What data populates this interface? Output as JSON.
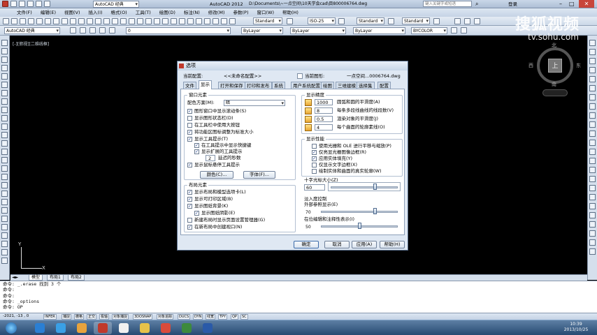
{
  "app": {
    "title": "AutoCAD 2012",
    "file_path": "D:\\Documents\\~一点空间\\10天学会cad\\目800006764.dwg",
    "workspace": "AutoCAD 经典",
    "search_placeholder": "键入关键字或短语",
    "login": "登录"
  },
  "menu": [
    "文件(F)",
    "编辑(E)",
    "视图(V)",
    "插入(I)",
    "格式(O)",
    "工具(T)",
    "绘图(D)",
    "标注(N)",
    "修改(M)",
    "参数(P)",
    "窗口(W)",
    "帮助(H)"
  ],
  "toolbar": {
    "text_style": "Standard",
    "dim_style": "ISO-25",
    "table_style": "Standard",
    "multileader_style": "Standard",
    "workspace_combo": "AutoCAD 经典",
    "layer": "0",
    "color": "ByLayer",
    "linetype": "ByLayer",
    "lineweight": "ByLayer",
    "plotstyle": "BYCOLOR"
  },
  "viewport_label": "[-][俯视][二维线框]",
  "watermark": {
    "brand": "搜狐视频",
    "url": "tv.sohu.com"
  },
  "viewcube": {
    "north": "北",
    "south": "南",
    "east": "东",
    "west": "西",
    "top": "上"
  },
  "layout_tabs": [
    "模型",
    "布局1",
    "布局2"
  ],
  "command_lines": [
    "命令: _.erase 找到 3 个",
    "命令:",
    "命令:",
    "命令: _options",
    "命令: OP"
  ],
  "status": {
    "coords": "-2021, -13 , 0",
    "buttons": [
      "INFER",
      "捕捉",
      "栅格",
      "正交",
      "极轴",
      "对象捕捉",
      "3DOSNAP",
      "对象追踪",
      "DUCS",
      "DYN",
      "线宽",
      "TPY",
      "QP",
      "SC"
    ]
  },
  "taskbar": {
    "time": "10:39",
    "date": "2013/10/25"
  },
  "dialog": {
    "title": "选项",
    "current_profile_label": "当前配置:",
    "current_profile_value": "<<未命名配置>>",
    "current_drawing_label": "当前图形:",
    "current_drawing_value": "一点空间...0006764.dwg",
    "tabs": [
      "文件",
      "显示",
      "打开和保存",
      "打印和发布",
      "系统",
      "用户系统配置",
      "绘图",
      "三维建模",
      "选择集",
      "配置"
    ],
    "active_tab": "显示",
    "window_elements": {
      "title": "窗口元素",
      "scheme_label": "配色方案(M):",
      "scheme_value": "暗",
      "checkboxes": [
        {
          "label": "图形窗口中显示滚动条(S)",
          "checked": true
        },
        {
          "label": "显示图形状态栏(D)",
          "checked": false
        },
        {
          "label": "在工具栏中使用大按钮",
          "checked": false
        },
        {
          "label": "将功能区图标调整为标准大小",
          "checked": true
        },
        {
          "label": "显示工具提示(T)",
          "checked": true
        },
        {
          "label": "在工具提示中显示快捷键",
          "checked": true
        },
        {
          "label": "显示扩展的工具提示",
          "checked": true
        },
        {
          "label": "显示鼠标悬停工具提示",
          "checked": true
        }
      ],
      "delay_value": "2",
      "delay_label": "延迟的秒数",
      "colors_button": "颜色(C)...",
      "fonts_button": "字体(F)..."
    },
    "layout_elements": {
      "title": "布局元素",
      "checkboxes": [
        {
          "label": "显示布局和模型选项卡(L)",
          "checked": true
        },
        {
          "label": "显示可打印区域(B)",
          "checked": true
        },
        {
          "label": "显示图纸背景(K)",
          "checked": true
        },
        {
          "label": "显示图纸阴影(E)",
          "checked": true
        },
        {
          "label": "新建布局时显示页面设置管理器(G)",
          "checked": false
        },
        {
          "label": "在新布局中创建视口(N)",
          "checked": true
        }
      ]
    },
    "display_resolution": {
      "title": "显示精度",
      "rows": [
        {
          "value": "1000",
          "label": "圆弧和圆的平滑度(A)"
        },
        {
          "value": "8",
          "label": "每条多段线曲线的线段数(V)"
        },
        {
          "value": "0.5",
          "label": "渲染对象的平滑度(J)"
        },
        {
          "value": "4",
          "label": "每个曲面的轮廓素线(O)"
        }
      ]
    },
    "display_performance": {
      "title": "显示性能",
      "checkboxes": [
        {
          "label": "使用光栅和 OLE 进行平移与缩放(P)",
          "checked": false
        },
        {
          "label": "仅亮显光栅图像边框(R)",
          "checked": true
        },
        {
          "label": "应用实体填充(Y)",
          "checked": true
        },
        {
          "label": "仅显示文字边框(X)",
          "checked": false
        },
        {
          "label": "绘制实体和曲面的真实轮廓(W)",
          "checked": false
        }
      ]
    },
    "crosshair": {
      "title": "十字光标大小(Z)",
      "value": "60",
      "fraction": 0.66
    },
    "fade_control": {
      "title": "淡入度控制",
      "xref_label": "外部参照显示(E)",
      "xref_value": "70",
      "xref_fraction": 0.7,
      "inplace_label": "在位编辑和注释性表示(I)",
      "inplace_value": "50",
      "inplace_fraction": 0.5
    },
    "buttons": {
      "ok": "确定",
      "cancel": "取消",
      "apply": "应用(A)",
      "help": "帮助(H)"
    }
  }
}
